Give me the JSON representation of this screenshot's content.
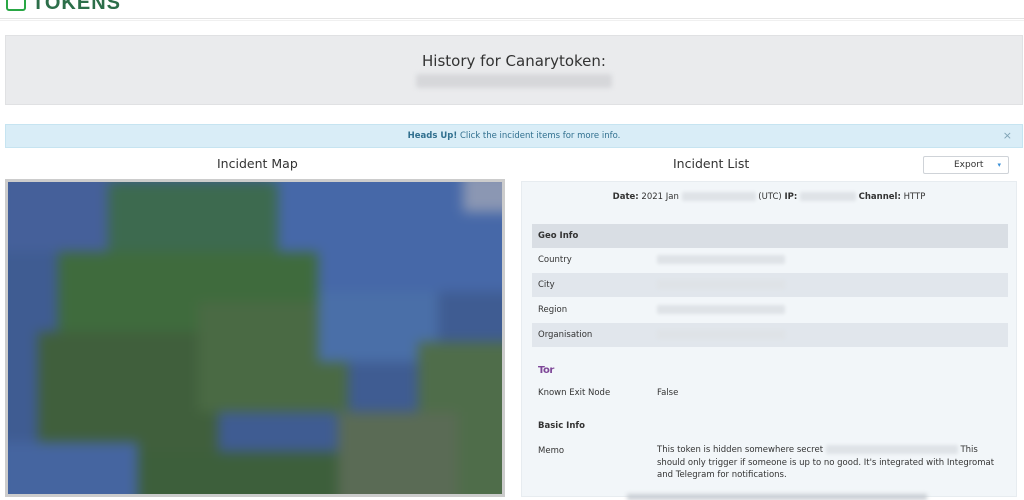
{
  "header": {
    "logo_text": "TOKENS",
    "logo_icon": "canary-logo-icon"
  },
  "history": {
    "title": "History for Canarytoken:"
  },
  "alert": {
    "strong": "Heads Up!",
    "text": " Click the incident items for more info.",
    "close": "×"
  },
  "map": {
    "title": "Incident Map"
  },
  "incidents": {
    "title": "Incident List",
    "export_label": "Export",
    "export_caret": "▾",
    "date_label": "Date:",
    "date_value": "2021 Jan",
    "utc_label": "(UTC)",
    "ip_label": "IP:",
    "channel_label": "Channel:",
    "channel_value": "HTTP",
    "geo": {
      "heading": "Geo Info",
      "country_label": "Country",
      "city_label": "City",
      "region_label": "Region",
      "org_label": "Organisation"
    },
    "tor": {
      "logo": "Tor",
      "exit_label": "Known Exit Node",
      "exit_value": "False"
    },
    "basic": {
      "heading": "Basic Info",
      "memo_label": "Memo",
      "memo_pre": "This token is hidden somewhere secret ",
      "memo_post": " This should only trigger if someone is up to no good. It's integrated with Integromat and Telegram for notifications."
    }
  },
  "colors": {
    "alert_bg": "#d9edf7",
    "alert_text": "#31708f",
    "panel_bg": "#f2f6f9",
    "tor_purple": "#7e4798",
    "brand_green": "#2c6e49"
  }
}
